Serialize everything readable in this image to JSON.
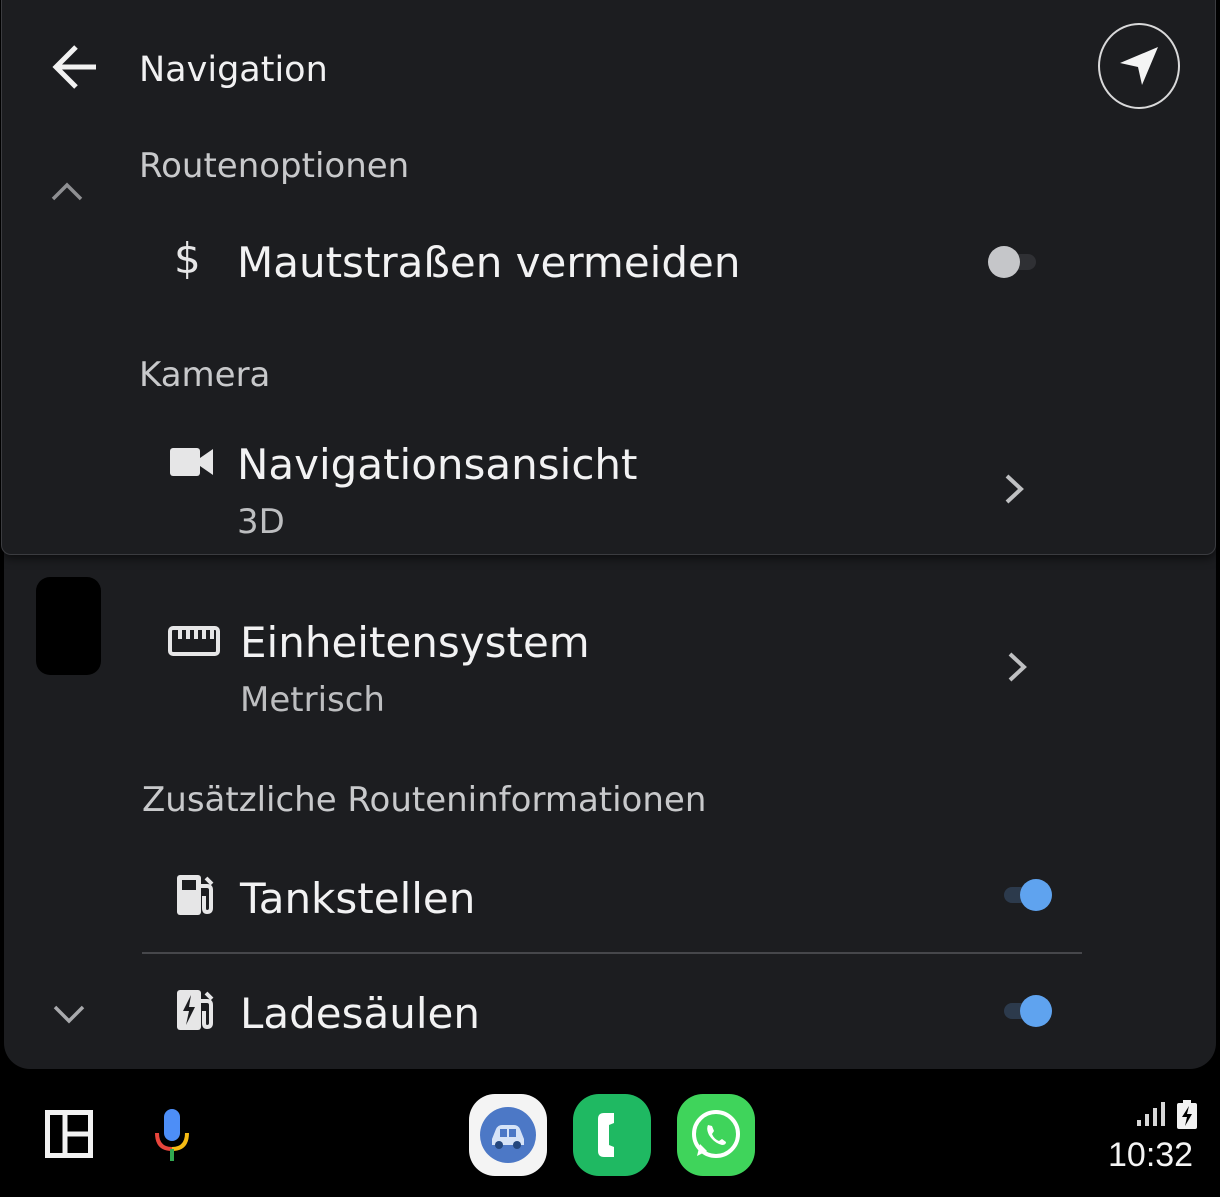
{
  "header": {
    "title": "Navigation",
    "back_icon": "arrow-left-icon",
    "nav_icon": "navigation-arrow-icon"
  },
  "sections": {
    "route_options": "Routenoptionen",
    "camera": "Kamera",
    "extra_route_info": "Zusätzliche Routeninformationen"
  },
  "items": {
    "avoid_tolls": {
      "label": "Mautstraßen vermeiden",
      "icon": "dollar-icon",
      "toggle": false
    },
    "nav_view": {
      "label": "Navigationsansicht",
      "value": "3D",
      "icon": "videocam-icon"
    },
    "units": {
      "label": "Einheitensystem",
      "value": "Metrisch",
      "icon": "ruler-icon"
    },
    "gas_stations": {
      "label": "Tankstellen",
      "icon": "gas-station-icon",
      "toggle": true
    },
    "charging": {
      "label": "Ladesäulen",
      "icon": "ev-charger-icon",
      "toggle": true
    }
  },
  "bottom_bar": {
    "apps": [
      "car-app-icon",
      "phone-app-icon",
      "whatsapp-icon"
    ],
    "time": "10:32"
  },
  "colors": {
    "background": "#1c1d20",
    "accent": "#5fa3ef",
    "phone_green": "#1fb962",
    "whatsapp_green": "#3fd45b"
  }
}
